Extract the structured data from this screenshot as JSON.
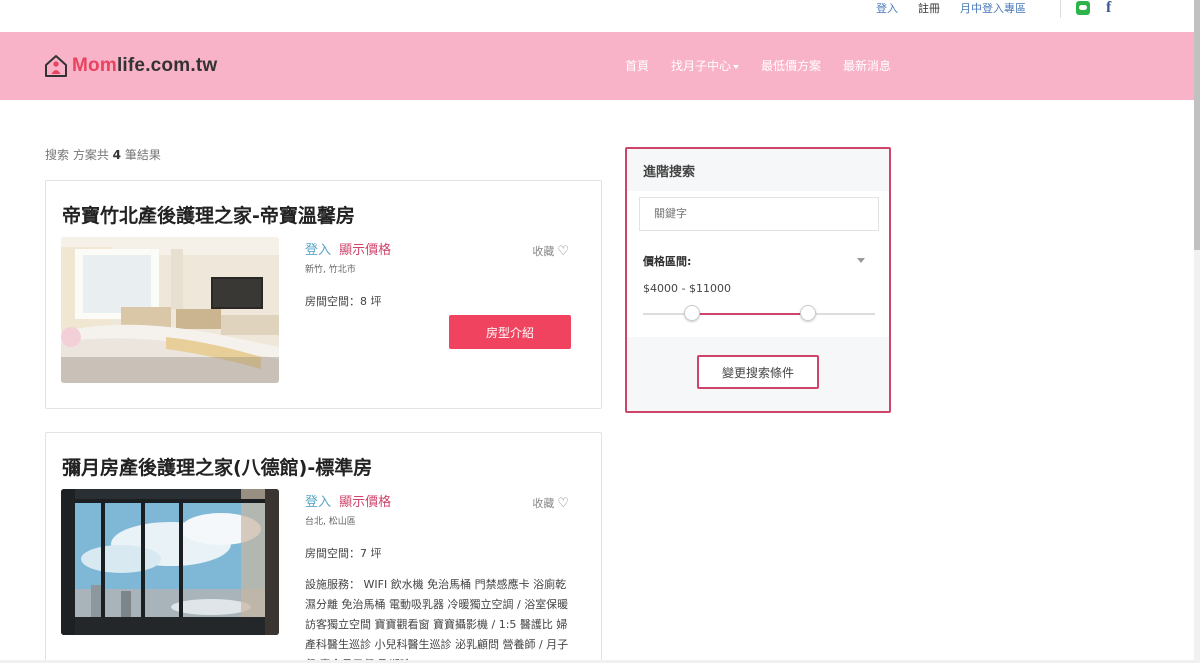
{
  "topbar": {
    "login": "登入",
    "register": "註冊",
    "center_login": "月中登入專區",
    "line_icon": "line-icon",
    "facebook_icon": "facebook-icon",
    "facebook_glyph": "f"
  },
  "header": {
    "logo_brand_prefix": "Mom",
    "logo_brand_suffix": "life.com.tw",
    "nav": {
      "home": "首頁",
      "find_center": "找月子中心",
      "lowest_price": "最低價方案",
      "news": "最新消息"
    }
  },
  "results": {
    "prefix": "搜索 方案共",
    "count": "4",
    "suffix": "筆結果"
  },
  "cards": [
    {
      "title": "帝寶竹北產後護理之家-帝寶溫馨房",
      "login": "登入",
      "show_price": "顯示價格",
      "location": "新竹, 竹北市",
      "room_size": "房間空間：8 坪",
      "favorite": "收藏",
      "button": "房型介紹"
    },
    {
      "title": "彌月房產後護理之家(八德館)-標準房",
      "login": "登入",
      "show_price": "顯示價格",
      "location": "台北, 松山區",
      "room_size": "房間空間：7 坪",
      "favorite": "收藏",
      "amenities": "設施服務： WIFI 飲水機 免治馬桶 門禁感應卡 浴廁乾濕分離 免治馬桶 電動吸乳器 冷暖獨立空調 / 浴室保暖 訪客獨立空間 寶寶觀看窗 寶寶攝影機 / 1:5 醫護比 婦產科醫生巡診 小兒科醫生巡診 泌乳顧問 營養師 / 月子餐 素食月子餐 孕期瑜"
    }
  ],
  "advanced_search": {
    "title": "進階搜索",
    "keyword_placeholder": "關鍵字",
    "price_label": "價格區間:",
    "range_min": "$4000",
    "range_sep": "-",
    "range_max": "$11000",
    "slider_min_fraction": 0.21,
    "slider_max_fraction": 0.71,
    "change_button": "變更搜索條件",
    "accent_color": "#d0446b"
  },
  "colors": {
    "header_bg": "#f9b3c9",
    "primary_button": "#f0435f"
  }
}
